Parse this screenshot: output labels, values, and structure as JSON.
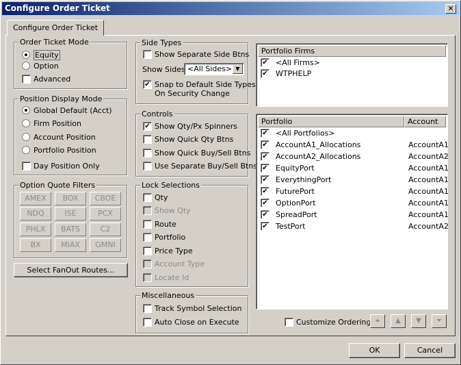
{
  "window": {
    "title": "Configure Order Ticket",
    "close_glyph": "✕"
  },
  "tab": {
    "label": "Configure Order Ticket"
  },
  "order_ticket_mode": {
    "legend": "Order Ticket Mode",
    "equity": "Equity",
    "option": "Option",
    "advanced": "Advanced"
  },
  "position_display_mode": {
    "legend": "Position Display Mode",
    "global_default": "Global Default (Acct)",
    "firm_position": "Firm Position",
    "account_position": "Account Position",
    "portfolio_position": "Portfolio Position",
    "day_position_only": "Day Position Only"
  },
  "option_quote_filters": {
    "legend": "Option Quote Filters",
    "buttons": [
      "AMEX",
      "BOX",
      "CBOE",
      "NDQ",
      "ISE",
      "PCX",
      "PHLX",
      "BATS",
      "C2",
      "BX",
      "MIAX",
      "GMNI"
    ]
  },
  "select_fanout": {
    "label": "Select FanOut Routes..."
  },
  "side_types": {
    "legend": "Side Types",
    "show_separate": "Show Separate Side Btns",
    "show_sides_label": "Show Sides",
    "show_sides_value": "<All Sides>",
    "snap_line1": "Snap to Default Side Types",
    "snap_line2": "On Security Change"
  },
  "controls": {
    "legend": "Controls",
    "qty_px_spinners": "Show Qty/Px Spinners",
    "quick_qty": "Show Quick Qty Btns",
    "quick_buy_sell": "Show Quick Buy/Sell Btns",
    "separate_buy_sell": "Use Separate Buy/Sell Btns"
  },
  "lock_selections": {
    "legend": "Lock Selections",
    "qty": "Qty",
    "show_qty": "Show Qty",
    "route": "Route",
    "portfolio": "Portfolio",
    "price_type": "Price Type",
    "account_type": "Account Type",
    "locate_id": "Locate Id"
  },
  "misc": {
    "legend": "Miscellaneous",
    "track_symbol": "Track Symbol Selection",
    "auto_close": "Auto Close on Execute"
  },
  "portfolio_firms": {
    "header": "Portfolio Firms",
    "items": [
      "<All Firms>",
      "WTPHELP"
    ]
  },
  "portfolio_list": {
    "col_portfolio": "Portfolio",
    "col_account": "Account",
    "rows": [
      {
        "name": "<All Portfolios>",
        "account": ""
      },
      {
        "name": "AccountA1_Allocations",
        "account": "AccountA1"
      },
      {
        "name": "AccountA2_Allocations",
        "account": "AccountA2"
      },
      {
        "name": "EquityPort",
        "account": "AccountA1"
      },
      {
        "name": "EverythingPort",
        "account": "AccountA1"
      },
      {
        "name": "FuturePort",
        "account": "AccountA1"
      },
      {
        "name": "OptionPort",
        "account": "AccountA1"
      },
      {
        "name": "SpreadPort",
        "account": "AccountA1"
      },
      {
        "name": "TestPort",
        "account": "AccountA2"
      }
    ]
  },
  "customize_ordering": {
    "label": "Customize Ordering"
  },
  "footer": {
    "ok": "OK",
    "cancel": "Cancel"
  },
  "check_glyph": "✔"
}
